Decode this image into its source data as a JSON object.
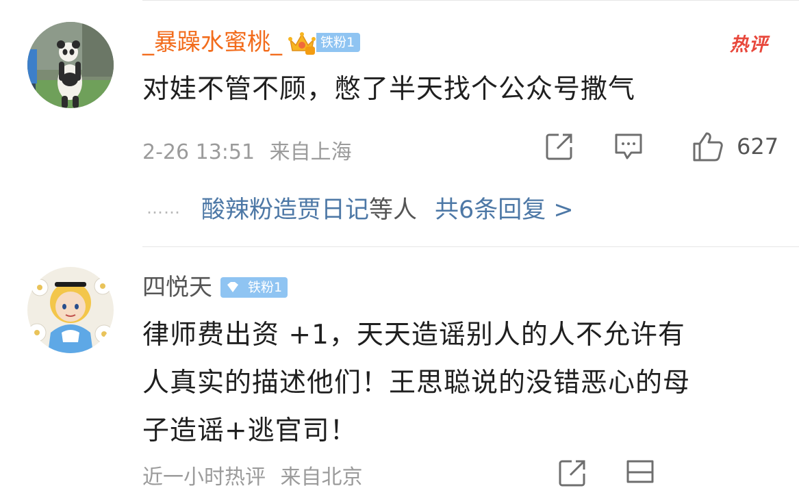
{
  "comments": [
    {
      "username": "_暴躁水蜜桃_",
      "fan_badge": "铁粉1",
      "hot_tag": "热评",
      "text": "对娃不管不顾，憋了半天找个公众号撒气",
      "time": "2-26 13:51",
      "location": "来自上海",
      "like_count": "627",
      "replies": {
        "dots": "……",
        "names": "酸辣粉造贾日记",
        "suffix": "等人",
        "count": "共6条回复 >"
      },
      "avatar": "panda-avatar"
    },
    {
      "username": "四悦天",
      "fan_badge": "铁粉1",
      "text_lines": [
        "律师费出资 +1，天天造谣别人的人不允许有",
        "人真实的描述他们！王思聪说的没错恶心的母",
        "子造谣+逃官司！"
      ],
      "time": "近一小时热评",
      "location": "来自北京",
      "avatar": "cartoon-girl-avatar"
    }
  ],
  "colors": {
    "username_orange": "#f26c1c",
    "badge_blue": "#8fc4f2",
    "link_blue": "#4d78a6",
    "hot_red": "#e8473b",
    "meta_gray": "#9b9b9b"
  },
  "icons": {
    "crown": "crown-icon",
    "diamond": "diamond-icon",
    "share": "share-icon",
    "comment": "comment-icon",
    "like": "thumbs-up-icon"
  }
}
